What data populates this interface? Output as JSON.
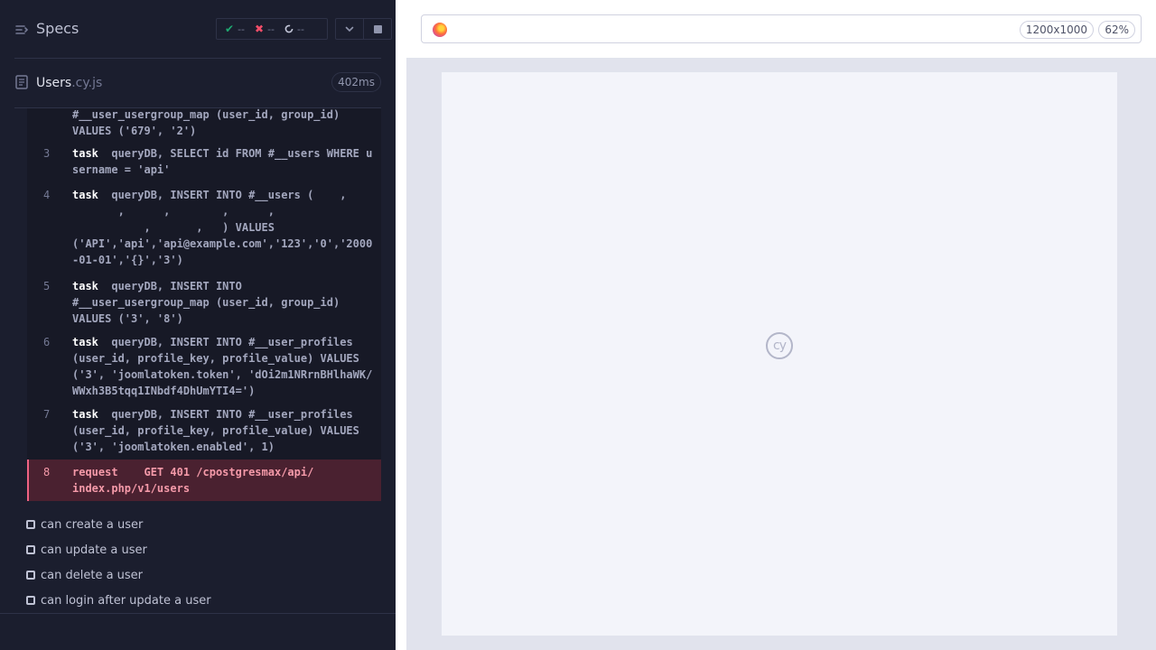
{
  "reporter": {
    "title": "Specs",
    "stats": {
      "passed": "--",
      "failed": "--",
      "pending": "--"
    },
    "file": {
      "name": "Users",
      "ext": ".cy.js",
      "duration": "402ms"
    },
    "log": [
      {
        "num": "",
        "cmd": "",
        "text": "#__user_usergroup_map (user_id, group_id)\nVALUES ('679', '2')"
      },
      {
        "num": "3",
        "cmd": "task",
        "text": "queryDB, SELECT id FROM #__users WHERE username = 'api'"
      },
      {
        "num": "4",
        "cmd": "task",
        "text": "queryDB, INSERT INTO #__users (    ,\n       ,      ,        ,      ,\n           ,       ,   ) VALUES\n('API','api','api@example.com','123','0','2000-01-01','{}','3')"
      },
      {
        "num": "5",
        "cmd": "task",
        "text": "queryDB, INSERT INTO\n#__user_usergroup_map (user_id, group_id)\nVALUES ('3', '8')"
      },
      {
        "num": "6",
        "cmd": "task",
        "text": "queryDB, INSERT INTO #__user_profiles\n(user_id, profile_key, profile_value) VALUES ('3', 'joomlatoken.token', 'dOi2m1NRrnBHlhaWK/WWxh3B5tqq1INbdf4DhUmYTI4=')"
      },
      {
        "num": "7",
        "cmd": "task",
        "text": "queryDB, INSERT INTO #__user_profiles\n(user_id, profile_key, profile_value) VALUES ('3', 'joomlatoken.enabled', 1)"
      },
      {
        "num": "8",
        "cmd": "request",
        "text": "GET 401 /cpostgresmax/api/\nindex.php/v1/users",
        "failed": true
      }
    ],
    "tests": [
      "can create a user",
      "can update a user",
      "can delete a user",
      "can login after update a user"
    ]
  },
  "aut": {
    "viewport": "1200x1000",
    "zoom": "62%",
    "logo_text": "cy"
  },
  "colors": {
    "pass": "#1fa971",
    "fail": "#f24e69",
    "failed_row_bg": "#4a2130",
    "reporter_bg": "#1b1e2e"
  }
}
